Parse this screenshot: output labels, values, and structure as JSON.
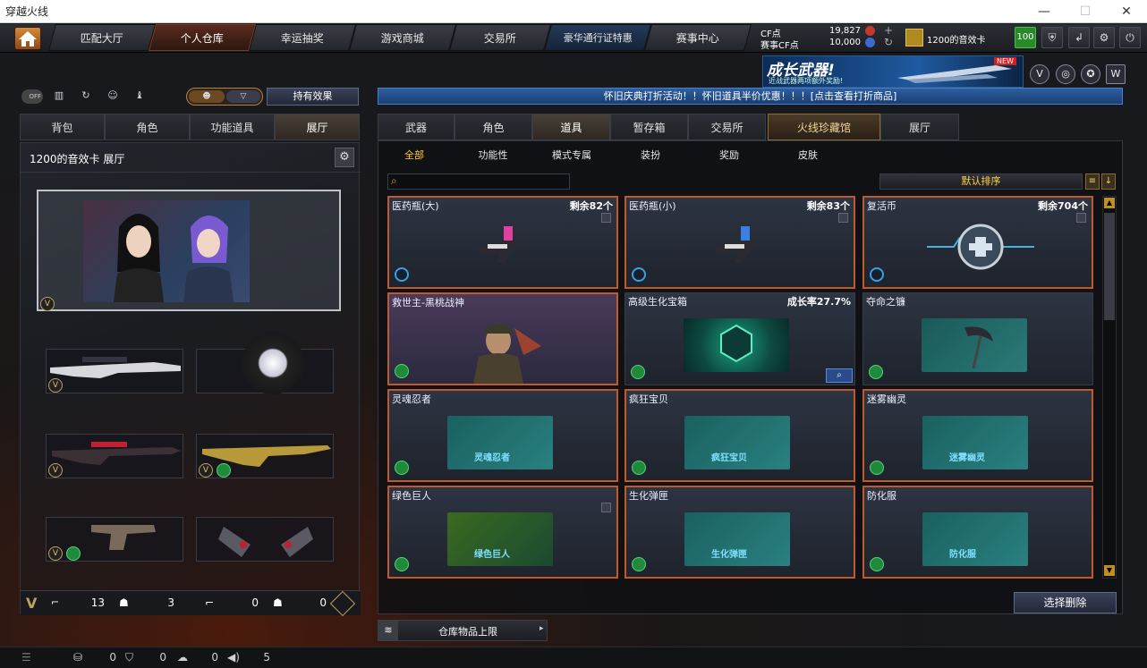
{
  "window": {
    "title": "穿越火线",
    "minimize": "—",
    "maximize": "☐",
    "close": "✕"
  },
  "nav": {
    "tabs": [
      "匹配大厅",
      "个人仓库",
      "幸运抽奖",
      "游戏商城",
      "交易所",
      "豪华通行证特惠",
      "赛事中心"
    ],
    "active": "个人仓库"
  },
  "currency": {
    "cf_label": "CF点",
    "cf_value": "19,827",
    "match_label": "赛事CF点",
    "match_value": "10,000",
    "card": "1200的音效卡",
    "level": "100"
  },
  "banner": {
    "text": "成长武器!",
    "sub": "近战武器两项额外奖励!",
    "tag": "NEW"
  },
  "left": {
    "toggle_off": "OFF",
    "effect_button": "持有效果",
    "tabs": [
      "背包",
      "角色",
      "功能道具",
      "展厅"
    ],
    "active_tab": "展厅",
    "hall_title": "1200的音效卡 展厅",
    "stats": {
      "gun1": "13",
      "mask1": "3",
      "gun2": "0",
      "mask2": "0"
    }
  },
  "right": {
    "notice": "怀旧庆典打折活动！！怀旧道具半价优惠！！！[点击查看打折商品]",
    "tabs": [
      "武器",
      "角色",
      "道具",
      "暂存箱",
      "交易所",
      "火线珍藏馆",
      "展厅"
    ],
    "active_tab": "道具",
    "subtabs": [
      "全部",
      "功能性",
      "模式专属",
      "装扮",
      "奖励",
      "皮肤"
    ],
    "active_subtab": "全部",
    "sort": "默认排序",
    "search_placeholder": "",
    "items": [
      {
        "name": "医药瓶(大)",
        "right": "剩余82个"
      },
      {
        "name": "医药瓶(小)",
        "right": "剩余83个"
      },
      {
        "name": "复活币",
        "right": "剩余704个"
      },
      {
        "name": "救世主-黑桃战神",
        "right": ""
      },
      {
        "name": "高级生化宝箱",
        "right": "成长率27.7%"
      },
      {
        "name": "夺命之镰",
        "right": ""
      },
      {
        "name": "灵魂忍者",
        "right": "",
        "label": "灵魂忍者"
      },
      {
        "name": "疯狂宝贝",
        "right": "",
        "label": "疯狂宝贝"
      },
      {
        "name": "迷雾幽灵",
        "right": "",
        "label": "迷雾幽灵"
      },
      {
        "name": "绿色巨人",
        "right": "",
        "label": "绿色巨人"
      },
      {
        "name": "生化弹匣",
        "right": "",
        "label": "生化弹匣"
      },
      {
        "name": "防化服",
        "right": "",
        "label": "防化服"
      }
    ],
    "delete_button": "选择删除",
    "storage": "仓库物品上限"
  },
  "footer": {
    "v1": "0",
    "v2": "0",
    "v3": "0",
    "v4": "5"
  }
}
